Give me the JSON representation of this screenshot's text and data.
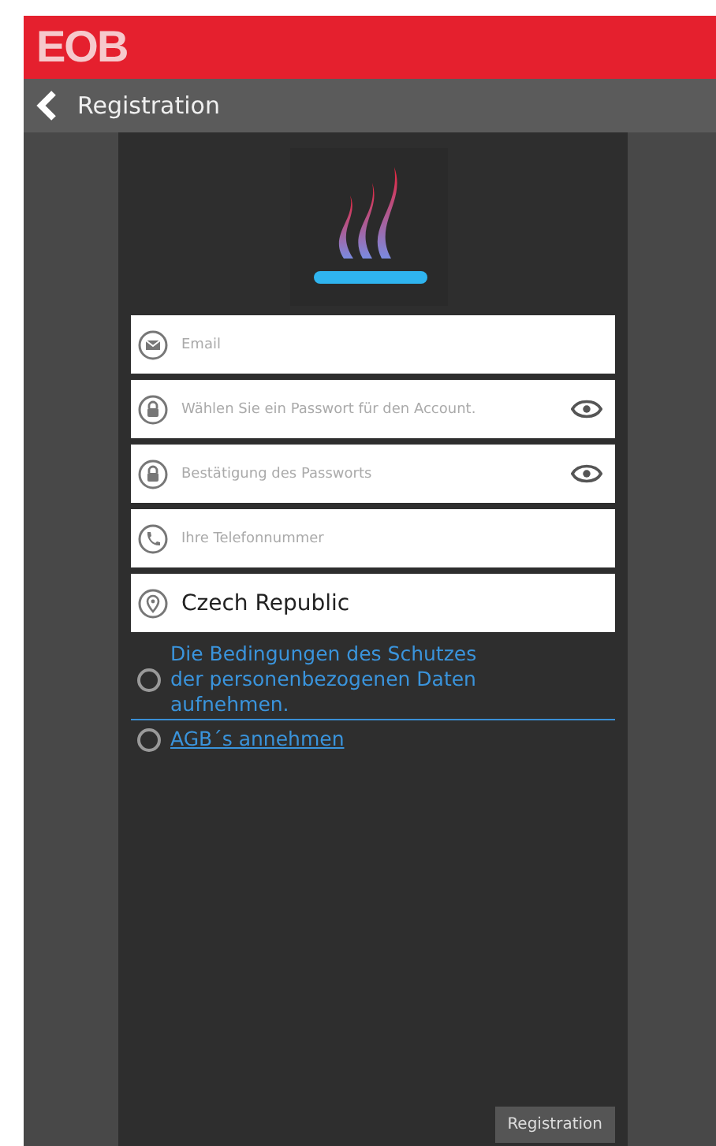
{
  "brand": {
    "logo": "EOB"
  },
  "header": {
    "title": "Registration"
  },
  "fields": [
    {
      "kind": "email",
      "placeholder": "Email",
      "reveal": false
    },
    {
      "kind": "password",
      "placeholder": "Wählen Sie ein Passwort für den Account.",
      "reveal": true
    },
    {
      "kind": "password",
      "placeholder": "Bestätigung des Passworts",
      "reveal": true
    },
    {
      "kind": "phone",
      "placeholder": "Ihre Telefonnummer",
      "reveal": false
    },
    {
      "kind": "location",
      "value": "Czech Republic",
      "reveal": false
    }
  ],
  "consents": [
    {
      "label": "Die Bedingungen des Schutzes der personenbezogenen Daten aufnehmen.",
      "checked": false
    },
    {
      "label": "AGB´s annehmen",
      "checked": false
    }
  ],
  "submit": "Registration"
}
